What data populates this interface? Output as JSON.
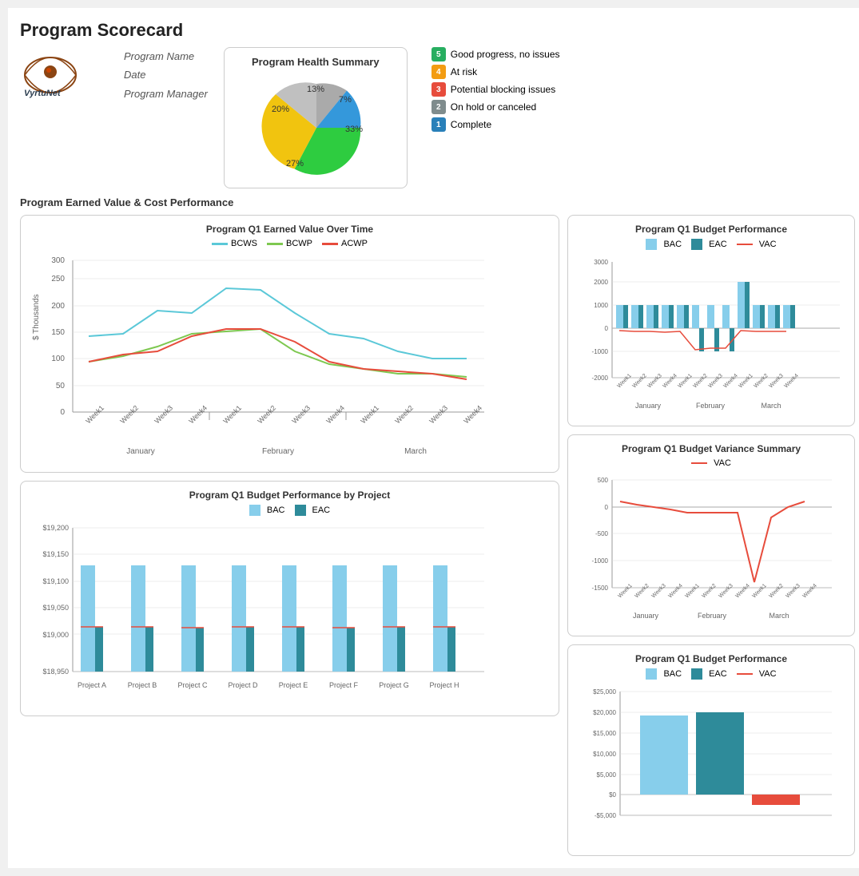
{
  "page": {
    "title": "Program Scorecard",
    "section_ev_label": "Program Earned Value & Cost Performance"
  },
  "logo": {
    "text": "VyrtuNet"
  },
  "program_info": {
    "name_label": "Program Name",
    "date_label": "Date",
    "manager_label": "Program Manager"
  },
  "health_summary": {
    "title": "Program Health Summary",
    "slices": [
      {
        "label": "33%",
        "color": "#2ecc40",
        "value": 33
      },
      {
        "label": "27%",
        "color": "#f1c40f",
        "value": 27
      },
      {
        "label": "20%",
        "color": "#e74c3c",
        "value": 20
      },
      {
        "label": "13%",
        "color": "#aaaaaa",
        "value": 13
      },
      {
        "label": "7%",
        "color": "#3498db",
        "value": 7
      }
    ]
  },
  "legend": {
    "items": [
      {
        "number": "5",
        "color": "#27ae60",
        "text": "Good progress, no issues"
      },
      {
        "number": "4",
        "color": "#f39c12",
        "text": "At risk"
      },
      {
        "number": "3",
        "color": "#e74c3c",
        "text": "Potential blocking issues"
      },
      {
        "number": "2",
        "color": "#7f8c8d",
        "text": "On hold or canceled"
      },
      {
        "number": "1",
        "color": "#2980b9",
        "text": "Complete"
      }
    ]
  },
  "charts": {
    "ev_over_time": {
      "title": "Program Q1 Earned Value Over Time",
      "y_label": "$ Thousands",
      "legend": [
        "BCWS",
        "BCWP",
        "ACWP"
      ],
      "legend_colors": [
        "#5bc8d8",
        "#7ec850",
        "#e74c3c"
      ]
    },
    "budget_perf": {
      "title": "Program Q1 Budget Performance",
      "legend": [
        "BAC",
        "EAC",
        "VAC"
      ],
      "legend_colors": [
        "#87ceeb",
        "#2e8b9a",
        "#e74c3c"
      ]
    },
    "budget_variance": {
      "title": "Program Q1 Budget Variance Summary",
      "legend": [
        "VAC"
      ],
      "legend_colors": [
        "#e74c3c"
      ]
    },
    "budget_perf2": {
      "title": "Program Q1 Budget Performance",
      "legend": [
        "BAC",
        "EAC",
        "VAC"
      ],
      "legend_colors": [
        "#87ceeb",
        "#2e8b9a",
        "#e74c3c"
      ]
    },
    "budget_by_project": {
      "title": "Program Q1 Budget Performance by Project",
      "legend": [
        "BAC",
        "EAC"
      ],
      "legend_colors": [
        "#87ceeb",
        "#2e8b9a"
      ],
      "projects": [
        "Project A",
        "Project B",
        "Project C",
        "Project D",
        "Project E",
        "Project F",
        "Project G",
        "Project H"
      ]
    }
  }
}
